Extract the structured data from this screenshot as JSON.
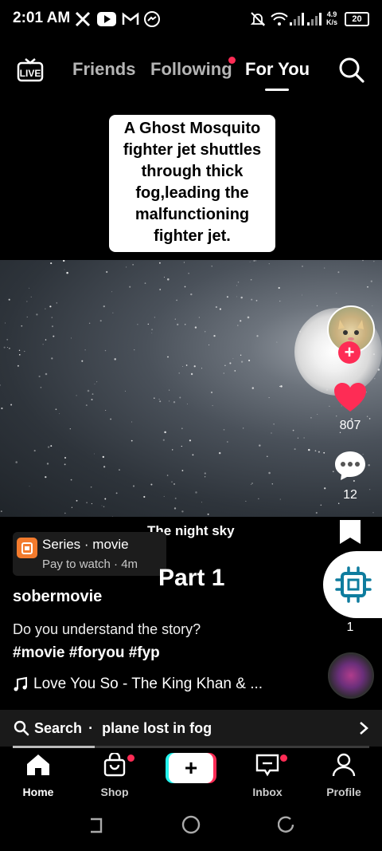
{
  "status_bar": {
    "time": "2:01 AM",
    "icons_left": [
      "x-icon",
      "youtube-icon",
      "gmail-icon",
      "messenger-icon"
    ],
    "icons_right": [
      "mute-icon",
      "wifi-icon",
      "signal-icon",
      "signal-icon"
    ],
    "net_speed": "4.9",
    "net_unit": "K/s",
    "battery": "20"
  },
  "top_nav": {
    "live_label": "LIVE",
    "tabs": [
      {
        "label": "Friends",
        "active": false
      },
      {
        "label": "Following",
        "active": false,
        "badge": true
      },
      {
        "label": "For You",
        "active": true
      }
    ]
  },
  "video": {
    "caption": "A Ghost Mosquito fighter jet shuttles through thick fog,leading the malfunctioning fighter jet.",
    "subtitle_1": "The night sky",
    "subtitle_2": "Part 1"
  },
  "series": {
    "title": "Series · movie",
    "subtitle": "Pay to watch · 4m"
  },
  "post": {
    "username": "sobermovie",
    "description": "Do you understand the story?",
    "hashtags": "#movie #foryou #fyp",
    "music": "Love You So - The King Khan & ..."
  },
  "actions": {
    "likes": "807",
    "comments": "12",
    "shares": "1"
  },
  "search": {
    "label": "Search",
    "separator": "·",
    "query": "plane lost in fog",
    "progress": 0.23
  },
  "bottom_nav": {
    "items": [
      {
        "label": "Home",
        "active": true
      },
      {
        "label": "Shop",
        "badge": true
      },
      {
        "label": "+"
      },
      {
        "label": "Inbox",
        "badge": true
      },
      {
        "label": "Profile"
      }
    ]
  },
  "colors": {
    "accent": "#fe2c55",
    "cyan": "#25f4ee",
    "chip": "#0e7c9e",
    "series_icon": "#f37b2d"
  }
}
